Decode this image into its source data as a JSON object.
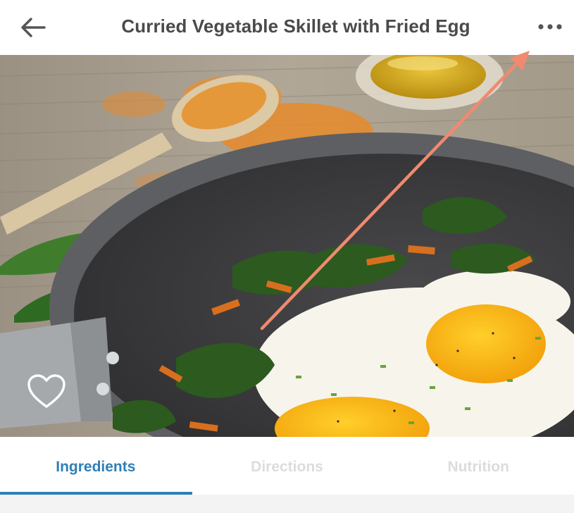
{
  "header": {
    "title": "Curried Vegetable Skillet with Fried Egg",
    "back_icon": "arrow-left-icon",
    "more_icon": "more-horizontal-icon"
  },
  "hero": {
    "favorite_icon": "heart-outline-icon"
  },
  "tabs": [
    {
      "label": "Ingredients",
      "active": true
    },
    {
      "label": "Directions",
      "active": false
    },
    {
      "label": "Nutrition",
      "active": false
    }
  ],
  "colors": {
    "accent": "#2f7fb5",
    "title_text": "#4a4a4a",
    "inactive_tab": "#dcdcdc",
    "annotation_arrow": "#f08a6f"
  }
}
